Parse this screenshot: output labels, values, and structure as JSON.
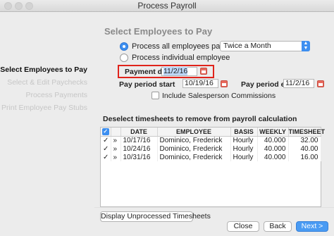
{
  "window": {
    "title": "Process Payroll"
  },
  "steps": [
    {
      "label": "Select Employees to Pay",
      "active": true
    },
    {
      "label": "Select & Edit Paychecks",
      "active": false
    },
    {
      "label": "Process Payments",
      "active": false
    },
    {
      "label": "Print Employee Pay Stubs",
      "active": false
    }
  ],
  "main": {
    "heading": "Select Employees to Pay",
    "radio_all": "Process all employees paid",
    "radio_individual": "Process individual employee",
    "frequency": "Twice a Month",
    "payment_date_label": "Payment date",
    "payment_date": "11/2/16",
    "period_start_label": "Pay period start",
    "period_start": "10/19/16",
    "period_end_label": "Pay period end",
    "period_end": "11/2/16",
    "include_commissions": "Include Salesperson Commissions",
    "deselect_text": "Deselect timesheets to remove from payroll calculation"
  },
  "table": {
    "columns": [
      "",
      "DATE",
      "EMPLOYEE",
      "BASIS",
      "WEEKLY",
      "TIMESHEET"
    ],
    "rows": [
      {
        "check": "✓",
        "date": "10/17/16",
        "employee": "Dominico, Frederick",
        "basis": "Hourly",
        "weekly": "40.000",
        "timesheet": "32.00"
      },
      {
        "check": "✓",
        "date": "10/24/16",
        "employee": "Dominico, Frederick",
        "basis": "Hourly",
        "weekly": "40.000",
        "timesheet": "40.00"
      },
      {
        "check": "✓",
        "date": "10/31/16",
        "employee": "Dominico, Frederick",
        "basis": "Hourly",
        "weekly": "40.000",
        "timesheet": "16.00"
      }
    ]
  },
  "buttons": {
    "unprocessed": "Display Unprocessed Timesheets",
    "close": "Close",
    "back": "Back",
    "next": "Next >"
  },
  "colors": {
    "accent": "#3d8ff0",
    "highlight": "#e0231b"
  }
}
